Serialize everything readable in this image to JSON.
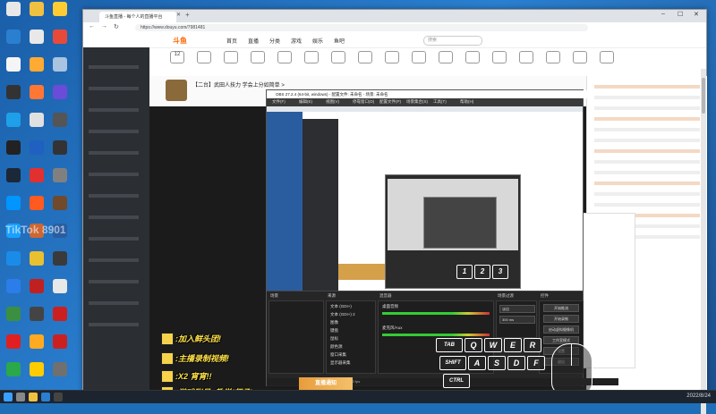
{
  "desktop": {
    "watermark": "TikTok 8901",
    "icons": [
      {
        "label": "",
        "color": "#e8e8e8"
      },
      {
        "label": "",
        "color": "#f0c040"
      },
      {
        "label": "",
        "color": "#ffcc33"
      },
      {
        "label": "",
        "color": "#2a7fd0"
      },
      {
        "label": "",
        "color": "#e8e8e8"
      },
      {
        "label": "",
        "color": "#e84a3a"
      },
      {
        "label": "",
        "color": "#f5f5f5"
      },
      {
        "label": "",
        "color": "#ffaa33"
      },
      {
        "label": "",
        "color": "#a8c4e0"
      },
      {
        "label": "",
        "color": "#333333"
      },
      {
        "label": "",
        "color": "#ff7733"
      },
      {
        "label": "",
        "color": "#6a4cd8"
      },
      {
        "label": "",
        "color": "#1ea0e8"
      },
      {
        "label": "",
        "color": "#e0e0e0"
      },
      {
        "label": "",
        "color": "#555555"
      },
      {
        "label": "",
        "color": "#222222"
      },
      {
        "label": "",
        "color": "#2060c0"
      },
      {
        "label": "",
        "color": "#333333"
      },
      {
        "label": "",
        "color": "#1b2838"
      },
      {
        "label": "",
        "color": "#e03030"
      },
      {
        "label": "",
        "color": "#808080"
      },
      {
        "label": "",
        "color": "#0095ff"
      },
      {
        "label": "",
        "color": "#ff5a1f"
      },
      {
        "label": "",
        "color": "#704a2a"
      },
      {
        "label": "",
        "color": "#1aa0ff"
      },
      {
        "label": "",
        "color": "#cc6633"
      },
      {
        "label": "",
        "color": "#2a5da0"
      },
      {
        "label": "",
        "color": "#1a8ce8"
      },
      {
        "label": "",
        "color": "#e8c030"
      },
      {
        "label": "",
        "color": "#3a3a3a"
      },
      {
        "label": "",
        "color": "#2b7de9"
      },
      {
        "label": "",
        "color": "#c02020"
      },
      {
        "label": "",
        "color": "#e8e8e8"
      },
      {
        "label": "",
        "color": "#3a9040"
      },
      {
        "label": "",
        "color": "#444444"
      },
      {
        "label": "",
        "color": "#cc2020"
      },
      {
        "label": "",
        "color": "#e02020"
      },
      {
        "label": "",
        "color": "#ffaa20"
      },
      {
        "label": "",
        "color": "#cc2020"
      },
      {
        "label": "",
        "color": "#2aa84a"
      },
      {
        "label": "",
        "color": "#ffcc00"
      },
      {
        "label": "",
        "color": "#707070"
      }
    ]
  },
  "browser": {
    "tab_title": "斗鱼直播 - 每个人的直播平台",
    "url": "https://www.douyu.com/7981481",
    "site": {
      "logo": "斗鱼",
      "nav": [
        "首页",
        "直播",
        "分类",
        "游戏",
        "娱乐",
        "鱼吧"
      ],
      "search_placeholder": "搜索",
      "categories": [
        "12",
        "",
        "",
        "",
        "",
        "",
        "",
        "",
        "",
        "",
        "",
        "",
        "",
        "",
        "",
        "",
        ""
      ],
      "room_title": "【二台】武田人技力 学会上分如简单 >",
      "sidebar_items": [
        "",
        "",
        "",
        "",
        "",
        "",
        "",
        "",
        "",
        "",
        "",
        "",
        ""
      ],
      "chat_lines": [
        "",
        "",
        "",
        "",
        "",
        "",
        "",
        "",
        "",
        "",
        "",
        "",
        "",
        "",
        ""
      ]
    }
  },
  "obs": {
    "title": "OBS 27.2.4 (64-bit, windows) - 配置文件: 未命名 - 场景: 未命名",
    "menu": [
      "文件(F)",
      "编辑(E)",
      "视图(V)",
      "停靠窗口(D)",
      "配置文件(P)",
      "场景集合(S)",
      "工具(T)",
      "帮助(H)"
    ],
    "docks": {
      "scenes_label": "场景",
      "sources_label": "来源",
      "mixer_label": "混音器",
      "transitions_label": "场景过渡",
      "controls_label": "控件"
    },
    "sources": [
      "文本 (GDI+)",
      "文本 (GDI+) 2",
      "图像",
      "键盘",
      "鼠标",
      "颜色源",
      "窗口采集",
      "显示器采集"
    ],
    "mixer": [
      "桌面音频",
      "麦克风/Aux"
    ],
    "transition": "淡出",
    "duration": "300 ms",
    "controls": [
      "开始推流",
      "开始录制",
      "启动虚拟摄像机",
      "工作室模式",
      "设置",
      "退出"
    ],
    "status": "录制: 00:00:00  CPU: 3.2%  30.00 fps"
  },
  "overlay": {
    "lines": [
      ":加入鲜头团!",
      ":主播录制视频!",
      ":X2 宵宵!!",
      ":游戏账号+教学(师承)"
    ],
    "banner": "直播通知"
  },
  "keyboard": {
    "row1": [
      "TAB",
      "Q",
      "W",
      "E",
      "R"
    ],
    "row2": [
      "SHIFT",
      "A",
      "S",
      "D",
      "F"
    ],
    "row3": [
      "CTRL"
    ],
    "top": [
      "1",
      "2",
      "3"
    ]
  },
  "taskbar": {
    "clock": "2022/8/24"
  }
}
